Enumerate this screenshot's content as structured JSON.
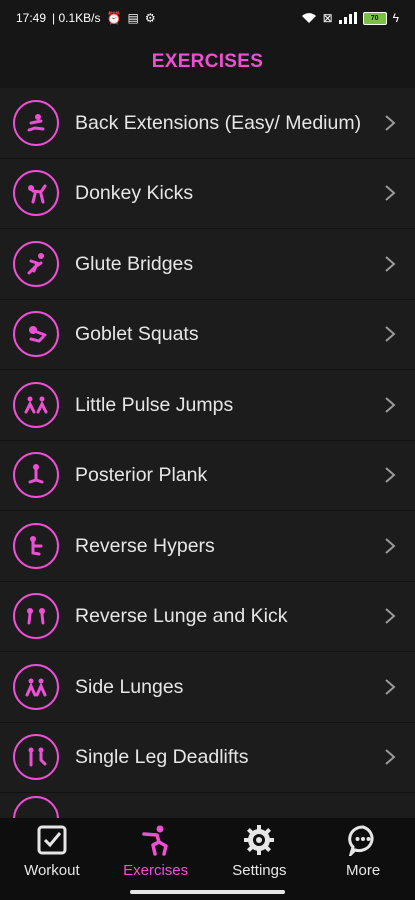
{
  "status_bar": {
    "time": "17:49",
    "speed": "| 0.1KB/s",
    "battery": "70",
    "colors": {
      "battery_fill": "#7ac143"
    }
  },
  "header": {
    "title": "EXERCISES"
  },
  "accent_color": "#ee4fd6",
  "exercises": [
    {
      "label": "Back Extensions (Easy/ Medium)",
      "icon": "back-extension-figure-icon"
    },
    {
      "label": "Donkey Kicks",
      "icon": "donkey-kick-figure-icon"
    },
    {
      "label": "Glute Bridges",
      "icon": "glute-bridge-figure-icon"
    },
    {
      "label": "Goblet Squats",
      "icon": "goblet-squat-figure-icon"
    },
    {
      "label": "Little Pulse Jumps",
      "icon": "pulse-jump-figure-icon"
    },
    {
      "label": "Posterior Plank",
      "icon": "posterior-plank-figure-icon"
    },
    {
      "label": "Reverse Hypers",
      "icon": "reverse-hyper-figure-icon"
    },
    {
      "label": "Reverse Lunge and Kick",
      "icon": "reverse-lunge-figure-icon"
    },
    {
      "label": "Side Lunges",
      "icon": "side-lunge-figure-icon"
    },
    {
      "label": "Single Leg Deadlifts",
      "icon": "single-leg-deadlift-figure-icon"
    }
  ],
  "bottom_nav": [
    {
      "label": "Workout",
      "icon": "checkbox-icon",
      "active": false
    },
    {
      "label": "Exercises",
      "icon": "squat-figure-icon",
      "active": true
    },
    {
      "label": "Settings",
      "icon": "gear-icon",
      "active": false
    },
    {
      "label": "More",
      "icon": "chat-bubble-icon",
      "active": false
    }
  ]
}
